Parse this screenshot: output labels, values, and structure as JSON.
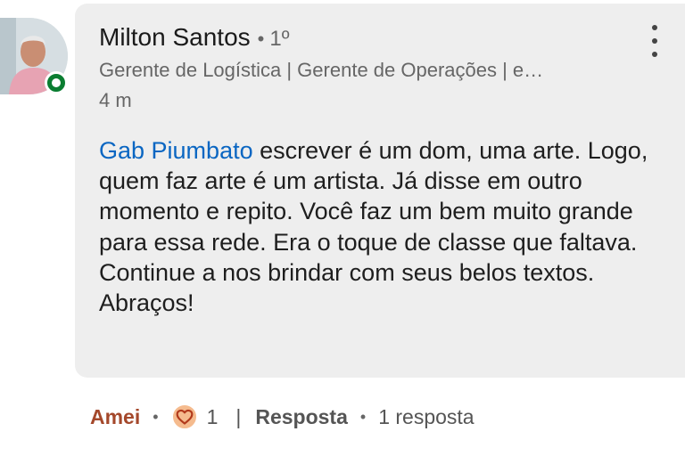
{
  "author": {
    "name": "Milton Santos",
    "separator": "•",
    "degree": "1º",
    "headline": "Gerente de Logística | Gerente de Operações | e…",
    "time": "4 m",
    "online": true
  },
  "comment": {
    "mention": "Gab Piumbato",
    "text": " escrever é um dom, uma arte. Logo, quem faz arte é um artista. Já disse em outro momento e repito. Você faz um bem muito grande para essa rede. Era o toque de classe que faltava.  Continue a nos brindar com seus belos textos. Abraços!"
  },
  "actions": {
    "like_label": "Amei",
    "dot": "•",
    "reaction_icon": "love-reaction-icon",
    "reaction_count": "1",
    "pipe": "|",
    "reply_label": "Resposta",
    "reply_count": "1 resposta"
  },
  "colors": {
    "mention": "#0a66c2",
    "liked": "#a4482b",
    "bubble": "#eeeeee",
    "online": "#0a7d31"
  }
}
